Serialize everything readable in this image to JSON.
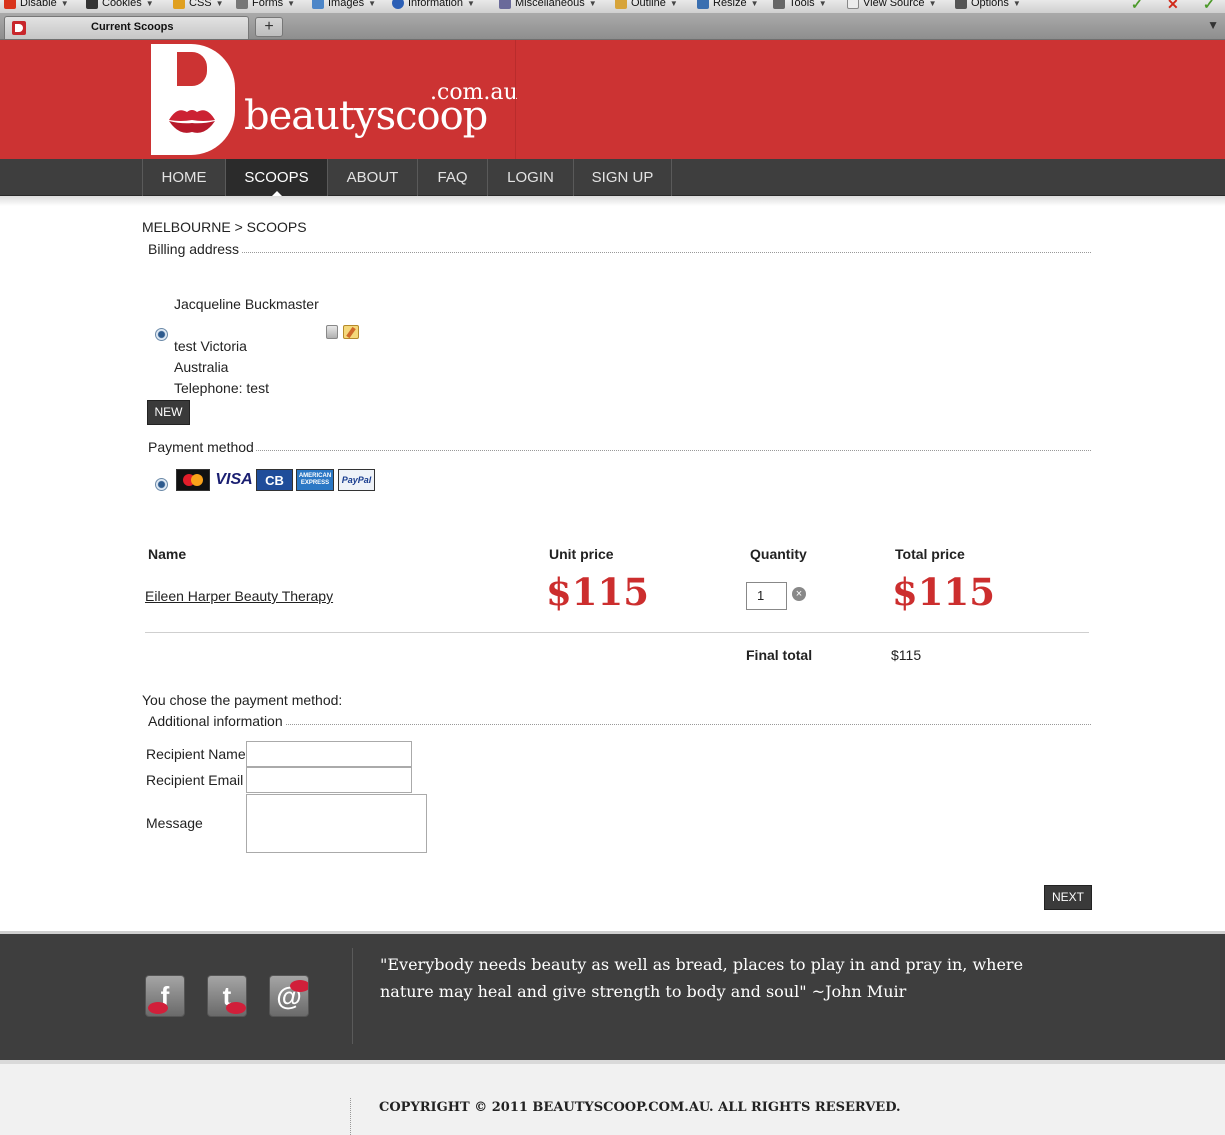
{
  "browser": {
    "toolbar": [
      "Disable",
      "Cookies",
      "CSS",
      "Forms",
      "Images",
      "Information",
      "Miscellaneous",
      "Outline",
      "Resize",
      "Tools",
      "View Source",
      "Options"
    ],
    "tab_title": "Current Scoops",
    "new_tab": "+"
  },
  "logo": {
    "b_letter": "B",
    "name_light": "beauty",
    "name_bold": "scoop",
    "domain": ".com.au"
  },
  "nav": [
    "HOME",
    "SCOOPS",
    "ABOUT",
    "FAQ",
    "LOGIN",
    "SIGN UP"
  ],
  "nav_active": "SCOOPS",
  "breadcrumb": "MELBOURNE > SCOOPS",
  "billing": {
    "legend": "Billing address",
    "name": "Jacqueline Buckmaster",
    "lines": [
      "test Victoria",
      "Australia",
      "Telephone: test"
    ],
    "new_button": "NEW"
  },
  "payment": {
    "legend": "Payment method",
    "cards": [
      "MasterCard",
      "VISA",
      "CB",
      "AMERICAN EXPRESS",
      "PayPal"
    ]
  },
  "cart": {
    "headers": {
      "name": "Name",
      "unit_price": "Unit price",
      "quantity": "Quantity",
      "total_price": "Total price"
    },
    "item": {
      "name": "Eileen Harper Beauty Therapy",
      "unit_price": "$115",
      "quantity": "1",
      "total_price": "$115"
    },
    "final_label": "Final total",
    "final_value": "$115"
  },
  "chose_text": "You chose the payment method:",
  "additional": {
    "legend": "Additional information",
    "recipient_name": "Recipient Name",
    "recipient_email": "Recipient Email",
    "message": "Message"
  },
  "next_button": "NEXT",
  "footer": {
    "social": [
      "facebook",
      "twitter",
      "email"
    ],
    "quote": "\"Everybody needs beauty as well as bread, places to play in and pray in, where nature may heal and give strength to body and soul\" ~John Muir",
    "copyright": "COPYRIGHT © 2011 BEAUTYSCOOP.COM.AU. ALL RIGHTS RESERVED."
  },
  "colors": {
    "brand_red": "#cc3333",
    "nav_dark": "#3e3e3e",
    "price_red": "#cc2e2e"
  }
}
